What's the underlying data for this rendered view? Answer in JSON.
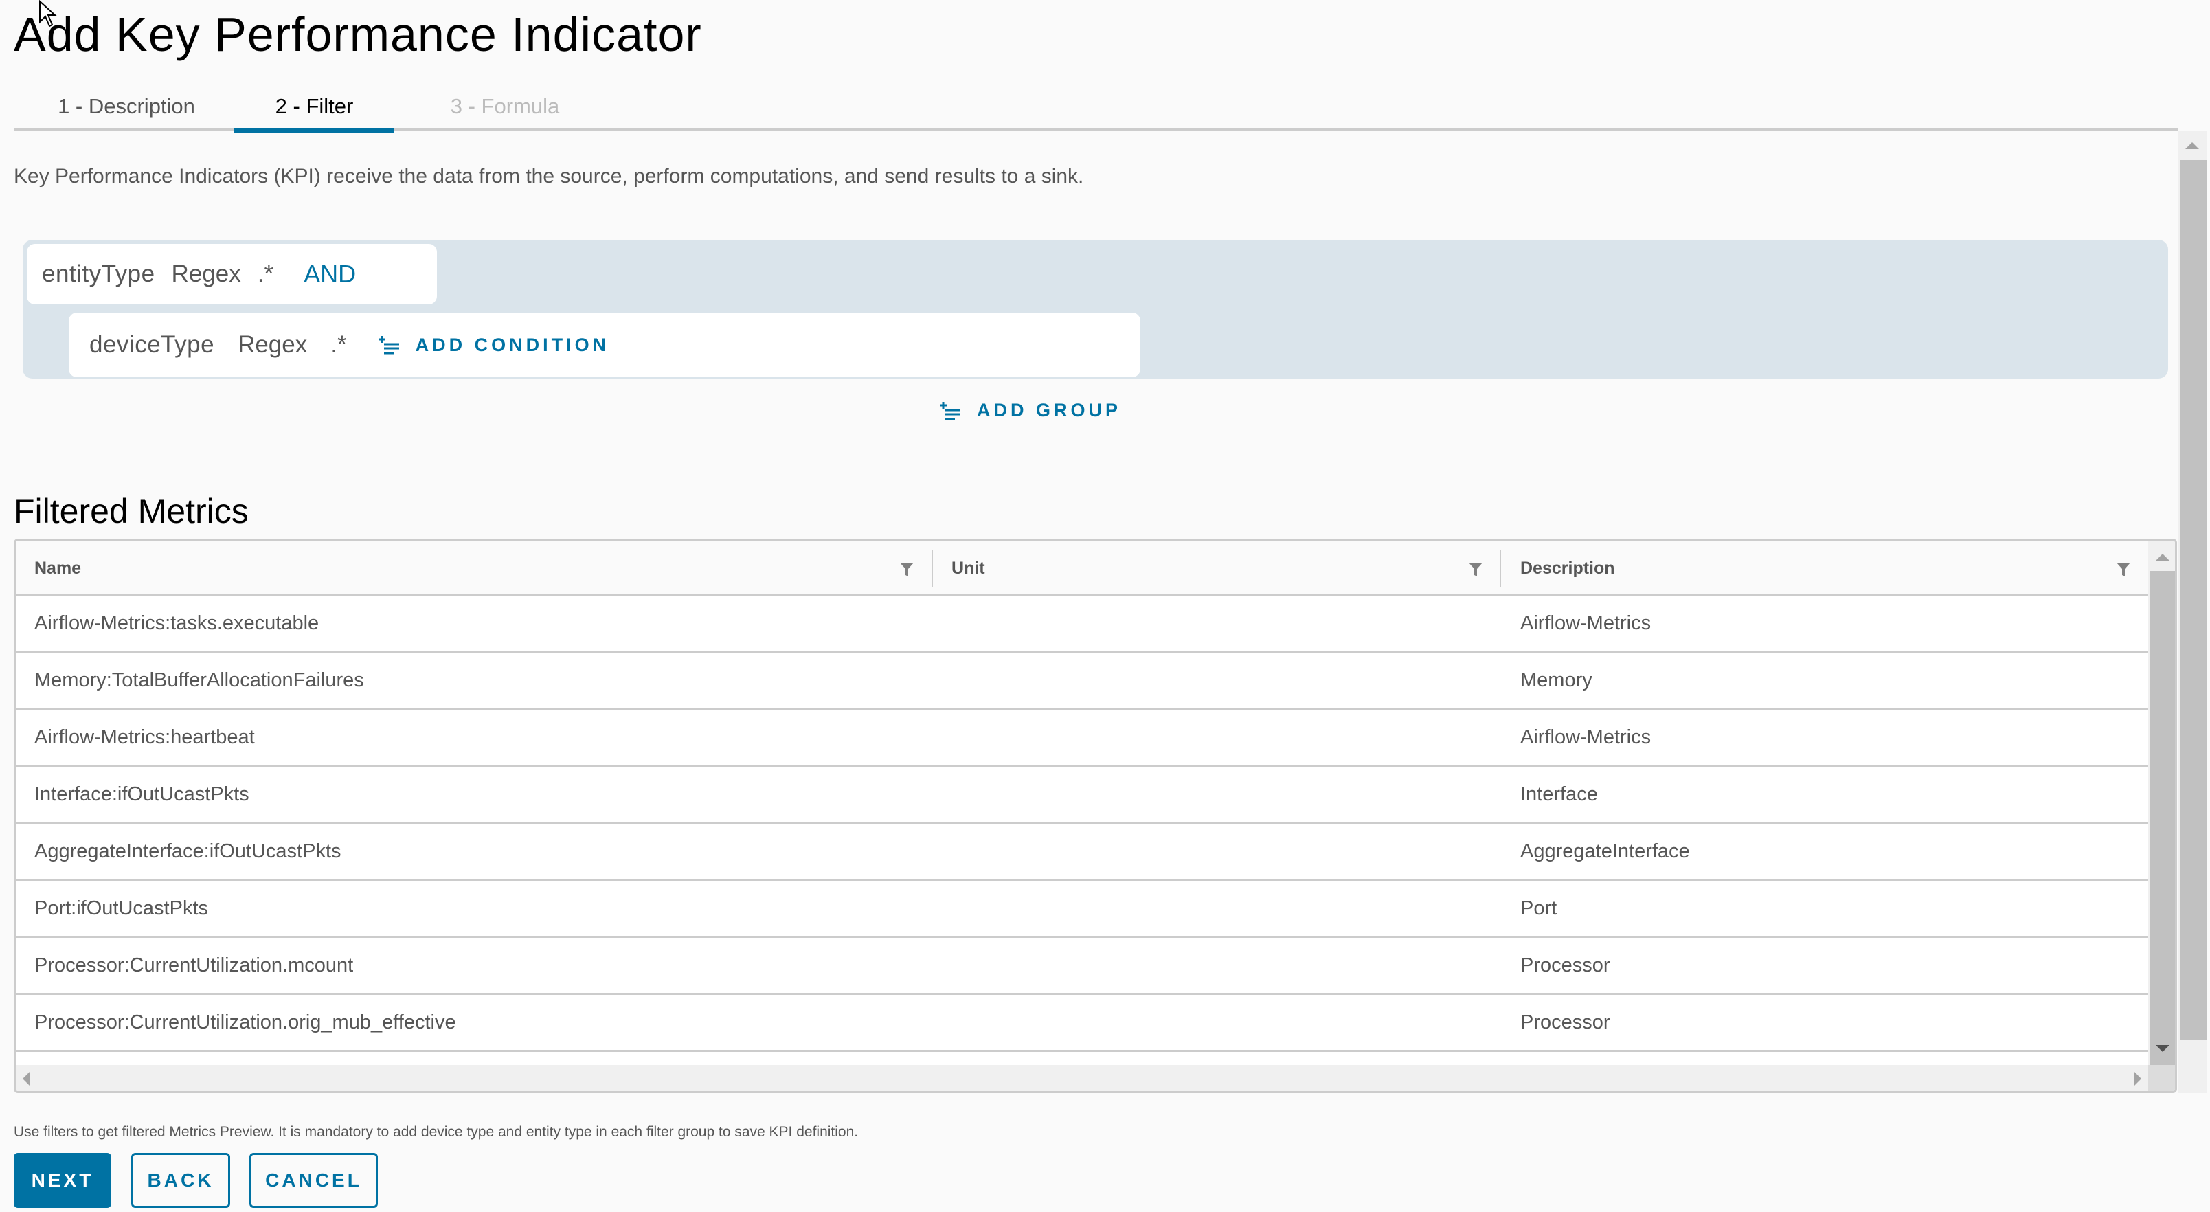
{
  "page": {
    "title": "Add Key Performance Indicator"
  },
  "tabs": [
    {
      "label": "1 - Description",
      "state": "completed"
    },
    {
      "label": "2 - Filter",
      "state": "active"
    },
    {
      "label": "3 - Formula",
      "state": "disabled"
    }
  ],
  "description": "Key Performance Indicators (KPI) receive the data from the source, perform computations, and send results to a sink.",
  "filter": {
    "group": {
      "conditions": [
        {
          "field": "entityType",
          "operator": "Regex",
          "value": ".*"
        },
        {
          "field": "deviceType",
          "operator": "Regex",
          "value": ".*"
        }
      ],
      "conjunction": "AND",
      "add_condition_label": "ADD CONDITION",
      "add_condition_icon": "add-list-icon"
    },
    "add_group_label": "ADD GROUP",
    "add_group_icon": "add-list-icon"
  },
  "metrics": {
    "title": "Filtered Metrics",
    "columns": [
      {
        "label": "Name",
        "icon": "filter-icon"
      },
      {
        "label": "Unit",
        "icon": "filter-icon"
      },
      {
        "label": "Description",
        "icon": "filter-icon"
      }
    ],
    "rows": [
      {
        "name": "Airflow-Metrics:tasks.executable",
        "unit": "",
        "description": "Airflow-Metrics"
      },
      {
        "name": "Memory:TotalBufferAllocationFailures",
        "unit": "",
        "description": "Memory"
      },
      {
        "name": "Airflow-Metrics:heartbeat",
        "unit": "",
        "description": "Airflow-Metrics"
      },
      {
        "name": "Interface:ifOutUcastPkts",
        "unit": "",
        "description": "Interface"
      },
      {
        "name": "AggregateInterface:ifOutUcastPkts",
        "unit": "",
        "description": "AggregateInterface"
      },
      {
        "name": "Port:ifOutUcastPkts",
        "unit": "",
        "description": "Port"
      },
      {
        "name": "Processor:CurrentUtilization.mcount",
        "unit": "",
        "description": "Processor"
      },
      {
        "name": "Processor:CurrentUtilization.orig_mub_effective",
        "unit": "",
        "description": "Processor"
      },
      {
        "name": "",
        "unit": "",
        "description": ""
      }
    ]
  },
  "footer": {
    "note": "Use filters to get filtered Metrics Preview. It is mandatory to add device type and entity type in each filter group to save KPI definition.",
    "buttons": {
      "next": "NEXT",
      "back": "BACK",
      "cancel": "CANCEL"
    }
  },
  "colors": {
    "accent": "#0072A3",
    "filter_group_bg": "#DAE4EB",
    "page_bg": "#FAFAFA",
    "border": "#CCCCCC",
    "text": "#565656",
    "disabled_text": "#BBBBBB"
  }
}
